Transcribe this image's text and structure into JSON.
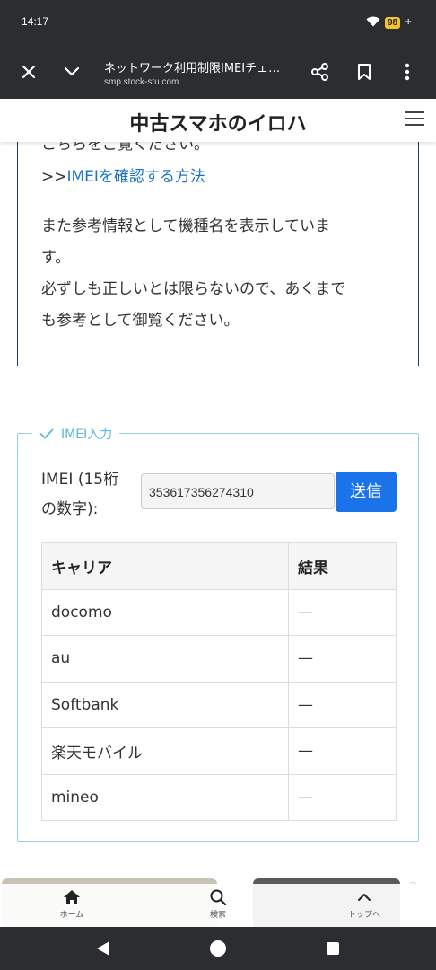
{
  "status": {
    "time": "14:17",
    "battery": "98"
  },
  "browser": {
    "title": "ネットワーク利用制限IMEIチェ…",
    "url": "smp.stock-stu.com"
  },
  "site": {
    "logo": "中古スマホのイロハ"
  },
  "info": {
    "line1": "こちらをご覧ください。",
    "link_prefix": ">>",
    "link_text": "IMEIを確認する方法",
    "line3": "また参考情報として機種名を表示していま",
    "line4": "す。",
    "line5": "必ずしも正しいとは限らないので、あくまで",
    "line6": "も参考として御覧ください。"
  },
  "form": {
    "legend": "IMEI入力",
    "label_line1": "IMEI (15桁",
    "label_line2": "の数字):",
    "imei_value": "353617356274310",
    "send_label": "送信"
  },
  "table": {
    "headers": [
      "キャリア",
      "結果"
    ],
    "rows": [
      {
        "carrier": "docomo",
        "result": "—"
      },
      {
        "carrier": "au",
        "result": "—"
      },
      {
        "carrier": "Softbank",
        "result": "—"
      },
      {
        "carrier": "楽天モバイル",
        "result": "—"
      },
      {
        "carrier": "mineo",
        "result": "—"
      }
    ]
  },
  "bottom_nav": {
    "home": "ホーム",
    "search": "検索",
    "top": "トップへ"
  },
  "colors": {
    "accent": "#1a73e8",
    "link": "#1a73c8",
    "legend": "#5db6dc"
  }
}
